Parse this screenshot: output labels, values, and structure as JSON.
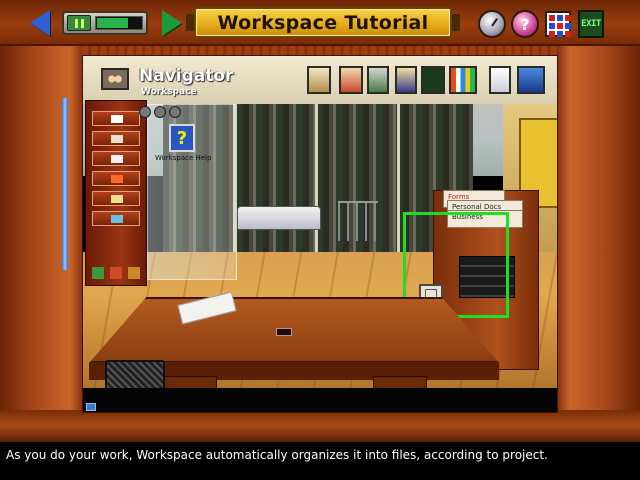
{
  "header": {
    "title": "Workspace Tutorial",
    "back_icon": "arrow-left-icon",
    "forward_icon": "arrow-right-icon",
    "playback": {
      "state": "pause-icon",
      "progress": 0.7
    },
    "tools": [
      "clock-icon",
      "help-icon",
      "grid-icon",
      "exit-icon"
    ],
    "exit_label": "EXIT"
  },
  "workspace": {
    "navigator_title": "Navigator",
    "navigator_subtitle": "Workspace",
    "help_shortcut_label": "Workspace Help",
    "help_glyph": "?",
    "folders": [
      "Forms",
      "Personal Docs",
      "Business"
    ],
    "app_icons": [
      "calendar-icon",
      "notes-icon",
      "calculator-icon",
      "contacts-icon",
      "charts-icon",
      "book-icon",
      "phone-icon",
      "monitor-icon"
    ]
  },
  "caption": {
    "text": "As you do your work, Workspace automatically organizes it into files, according to project."
  }
}
